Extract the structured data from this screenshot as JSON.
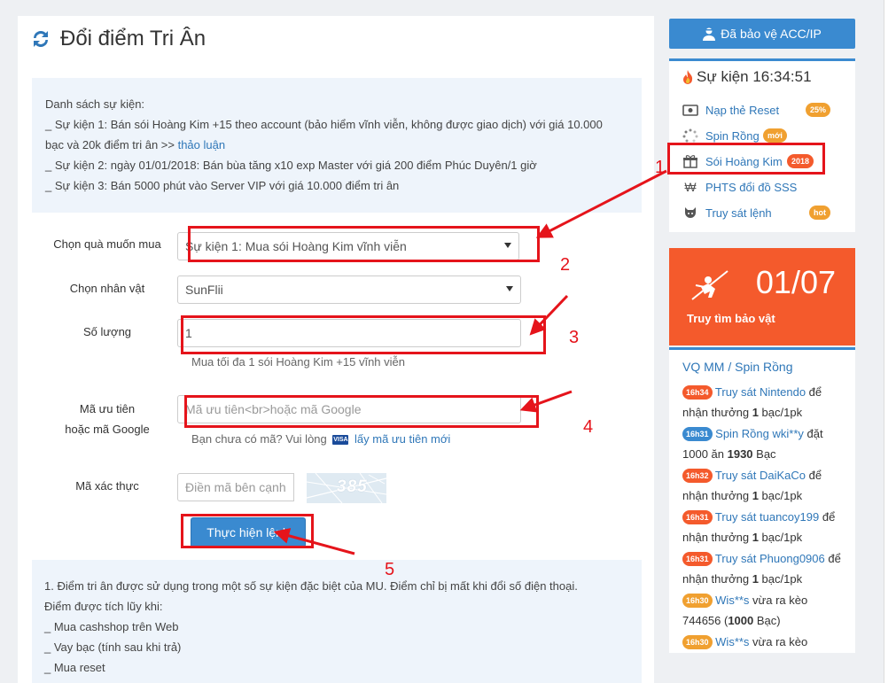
{
  "page": {
    "title": "Đổi điểm Tri Ân"
  },
  "info": {
    "heading": "Danh sách sự kiện:",
    "line1": "_ Sự kiện 1: Bán sói Hoàng Kim +15 theo account (bảo hiểm vĩnh viễn, không được giao dịch) với giá 10.000",
    "line2_prefix": "bạc và 20k điểm tri ân >> ",
    "line2_link": "thảo luận",
    "line3": "_ Sự kiện 2: ngày 01/01/2018: Bán bùa tăng x10 exp Master với giá 200 điểm Phúc Duyên/1 giờ",
    "line4": "_ Sự kiện 3: Bán 5000 phút vào Server VIP với giá 10.000 điểm tri ân"
  },
  "form": {
    "gift_label": "Chọn quà muốn mua",
    "gift_value": "Sự kiện 1: Mua sói Hoàng Kim vĩnh viễn",
    "char_label": "Chọn nhân vật",
    "char_value": "SunFlii",
    "qty_label": "Số lượng",
    "qty_value": "1",
    "qty_hint": "Mua tối đa 1 sói Hoàng Kim +15 vĩnh viễn",
    "promo_label_1": "Mã ưu tiên",
    "promo_label_2": "hoặc mã Google",
    "promo_placeholder": "Mã ưu tiên<br>hoặc mã Google",
    "promo_hint_prefix": "Bạn chưa có mã? Vui lòng",
    "promo_hint_visa": "VISA",
    "promo_hint_link": "lấy mã ưu tiên mới",
    "captcha_label": "Mã xác thực",
    "captcha_placeholder": "Điền mã bên cạnh",
    "captcha_text": "385",
    "submit_label": "Thực hiện lệnh"
  },
  "notes": {
    "line1": "1. Điểm tri ân được sử dụng trong một số sự kiện đặc biệt của MU. Điểm chỉ bị mất khi đổi số điện thoại.",
    "line2": "Điểm được tích lũy khi:",
    "line3": "_ Mua cashshop trên Web",
    "line4": "_ Vay bạc (tính sau khi trả)",
    "line5": "_ Mua reset"
  },
  "annotations": [
    "1",
    "2",
    "3",
    "4",
    "5"
  ],
  "sidebar": {
    "protect_label": "Đã bảo vệ ACC/IP",
    "events_title": "Sự kiện 16:34:51",
    "events": [
      {
        "label": "Nạp thẻ Reset",
        "badge": "25%",
        "icon": "card-icon"
      },
      {
        "label": "Spin Rồng",
        "badge": "mới",
        "icon": "spinner-icon"
      },
      {
        "label": "Sói Hoàng Kim",
        "badge": "2018",
        "icon": "gift-icon"
      },
      {
        "label": "PHTS đổi đồ SSS",
        "badge": "",
        "icon": "won-icon"
      },
      {
        "label": "Truy sát lệnh",
        "badge": "hot",
        "icon": "octocat-icon"
      }
    ],
    "promo_date": "01/07",
    "promo_label": "Truy tìm bảo vật",
    "feed_title": "VQ MM / Spin Rồng",
    "feed": [
      {
        "time": "16h34",
        "color": "red",
        "link": "Truy sát Nintendo",
        "rest": " để nhận thưởng ",
        "bold": "1",
        "tail": " bạc/1pk"
      },
      {
        "time": "16h31",
        "color": "blue",
        "link": "Spin Rồng wki**y",
        "rest": " đặt 1000 ăn ",
        "bold": "1930",
        "tail": " Bạc"
      },
      {
        "time": "16h32",
        "color": "red",
        "link": "Truy sát DaiKaCo",
        "rest": " để nhận thưởng ",
        "bold": "1",
        "tail": " bạc/1pk"
      },
      {
        "time": "16h31",
        "color": "red",
        "link": "Truy sát tuancoy199",
        "rest": " để nhận thưởng ",
        "bold": "1",
        "tail": " bạc/1pk"
      },
      {
        "time": "16h31",
        "color": "red",
        "link": "Truy sát Phuong0906",
        "rest": " để nhận thưởng ",
        "bold": "1",
        "tail": " bạc/1pk"
      },
      {
        "time": "16h30",
        "color": "orange",
        "link": "Wis**s",
        "rest": " vừa ra kèo 744656 (",
        "bold": "1000",
        "tail": " Bạc)"
      },
      {
        "time": "16h30",
        "color": "orange",
        "link": "Wis**s",
        "rest": " vừa ra kèo",
        "bold": "",
        "tail": ""
      }
    ]
  },
  "colors": {
    "primary": "#3a8ad0",
    "orange": "#f45a2c",
    "badge": "#f0a030",
    "annotation": "#e5141b"
  }
}
